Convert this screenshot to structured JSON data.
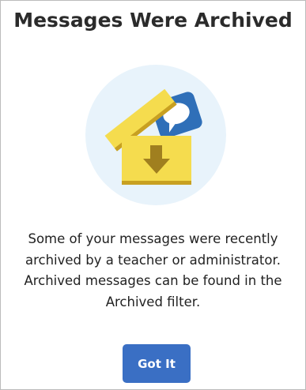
{
  "dialog": {
    "title": "Messages Were Archived",
    "illustration_icon": "archive-box-icon",
    "message_lines": [
      "Some of your messages were recently",
      "archived by a teacher or administrator.",
      "Archived messages can be found in the",
      "Archived filter."
    ],
    "button_label": "Got It"
  },
  "colors": {
    "accent": "#3a6fc4",
    "box_yellow": "#f5dc4e",
    "box_shadow": "#c8a021",
    "arrow": "#a07f1f",
    "bubble_blue": "#2f6fb8",
    "circle_bg": "#e8f3fb"
  }
}
